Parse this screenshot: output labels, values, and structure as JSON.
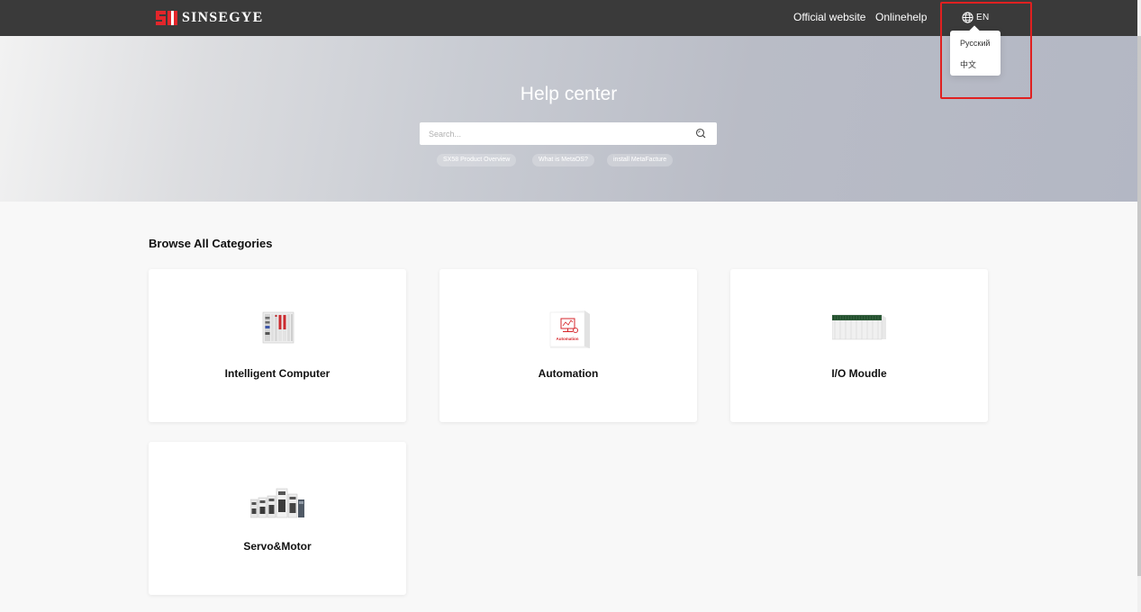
{
  "header": {
    "brand": "SINSEGYE",
    "nav": {
      "official_website": "Official website",
      "online_help": "Onlinehelp"
    },
    "language": {
      "current": "EN",
      "options": [
        "Русский",
        "中文"
      ]
    }
  },
  "hero": {
    "title": "Help center",
    "search": {
      "placeholder": "Search..."
    },
    "tags": [
      "SX58 Product Overview",
      "What is MetaOS?",
      "install MetaFacture"
    ]
  },
  "categories": {
    "title": "Browse All Categories",
    "items": [
      {
        "label": "Intelligent Computer",
        "icon": "intelligent-computer-image"
      },
      {
        "label": "Automation",
        "icon": "automation-image",
        "image_text": "Automation"
      },
      {
        "label": "I/O Moudle",
        "icon": "io-module-image"
      },
      {
        "label": "Servo&Motor",
        "icon": "servo-motor-image"
      }
    ]
  },
  "colors": {
    "topbar": "#3a3a3a",
    "brand_red": "#e3262b",
    "highlight": "#e02020",
    "page_bg": "#f8f8f8"
  }
}
